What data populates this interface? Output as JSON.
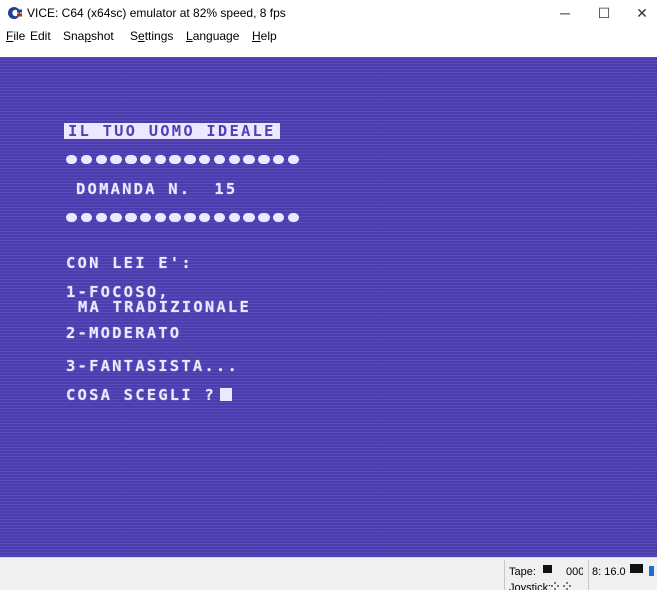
{
  "window": {
    "title": "VICE: C64 (x64sc) emulator at 82% speed, 8 fps",
    "minimize_glyph": "─",
    "maximize_glyph": "☐",
    "close_glyph": "✕"
  },
  "menu": {
    "items": [
      {
        "accel": "F",
        "rest": "ile"
      },
      {
        "accel": "",
        "rest": "Edit"
      },
      {
        "pre": "Sna",
        "accel": "p",
        "rest": "shot"
      },
      {
        "pre": "S",
        "accel": "e",
        "rest": "ttings"
      },
      {
        "accel": "L",
        "rest": "anguage"
      },
      {
        "accel": "H",
        "rest": "elp"
      }
    ]
  },
  "screen": {
    "title_line": "IL TUO UOMO IDEALE",
    "question_line": "DOMANDA N.  15",
    "prompt_line": "CON LEI E':",
    "option1_line1": "1-FOCOSO,",
    "option1_line2": "MA TRADIZIONALE",
    "option2_line": "2-MODERATO",
    "option3_line": "3-FANTASISTA...",
    "input_prompt": "COSA SCEGLI ?",
    "dots_count": 16,
    "colors": {
      "background": "#5041b8",
      "foreground": "#ece8ff"
    }
  },
  "status": {
    "tape_label": "Tape:",
    "tape_counter": "000",
    "drive_label": "8: 16.0",
    "joystick_label": "Joystick:"
  }
}
